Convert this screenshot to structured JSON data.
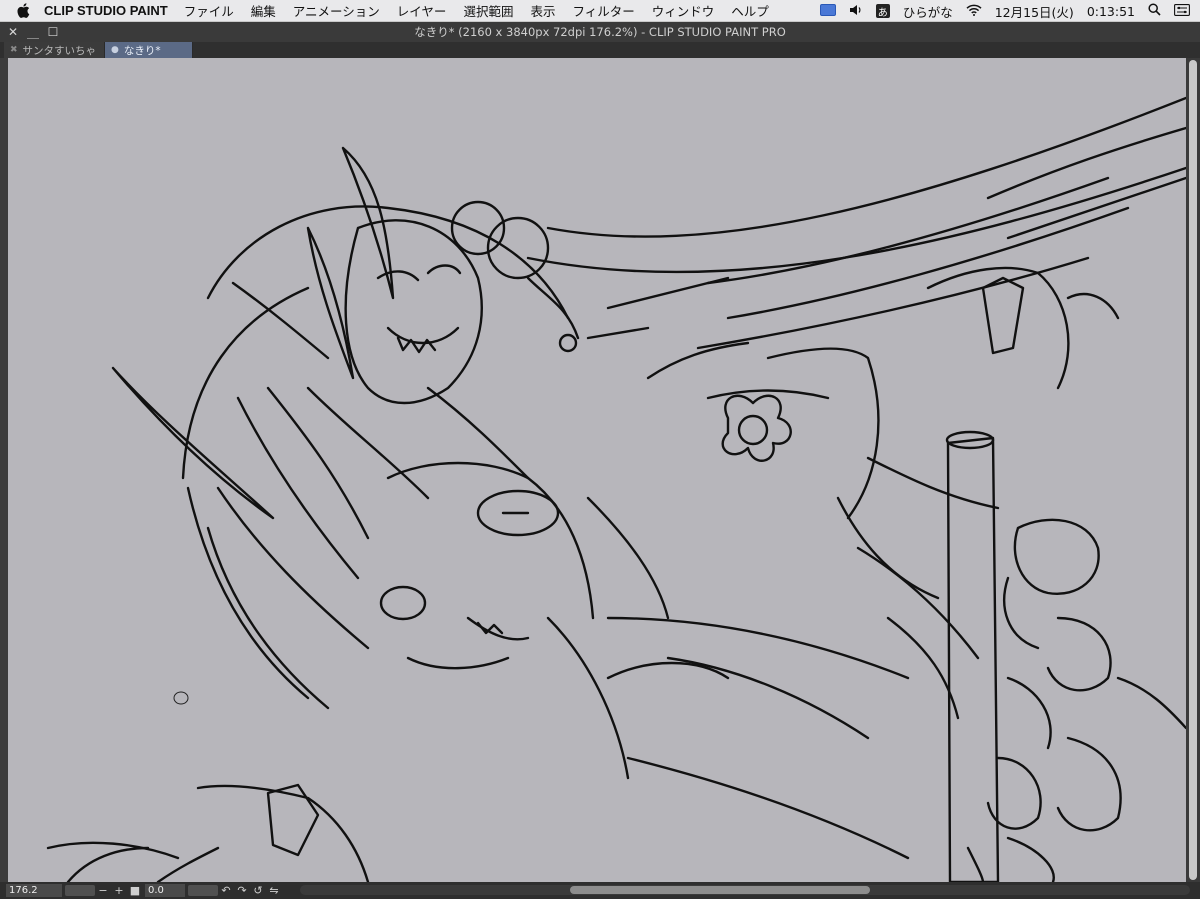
{
  "menubar": {
    "app_name": "CLIP STUDIO PAINT",
    "items": [
      "ファイル",
      "編集",
      "アニメーション",
      "レイヤー",
      "選択範囲",
      "表示",
      "フィルター",
      "ウィンドウ",
      "ヘルプ"
    ],
    "ime_badge": "あ",
    "ime_label": "ひらがな",
    "date": "12月15日(火)",
    "time": "0:13:51"
  },
  "window": {
    "title": "なきり* (2160 x 3840px 72dpi 176.2%)  - CLIP STUDIO PAINT PRO"
  },
  "tabs": [
    {
      "label": "サンタすいちゃ",
      "active": false
    },
    {
      "label": "なきり*",
      "active": true
    }
  ],
  "statusbar": {
    "zoom": "176.2",
    "rotation": "0.0"
  },
  "colors": {
    "canvas": "#b7b6bb",
    "line": "#111111",
    "active_tab": "#5b6a86"
  }
}
